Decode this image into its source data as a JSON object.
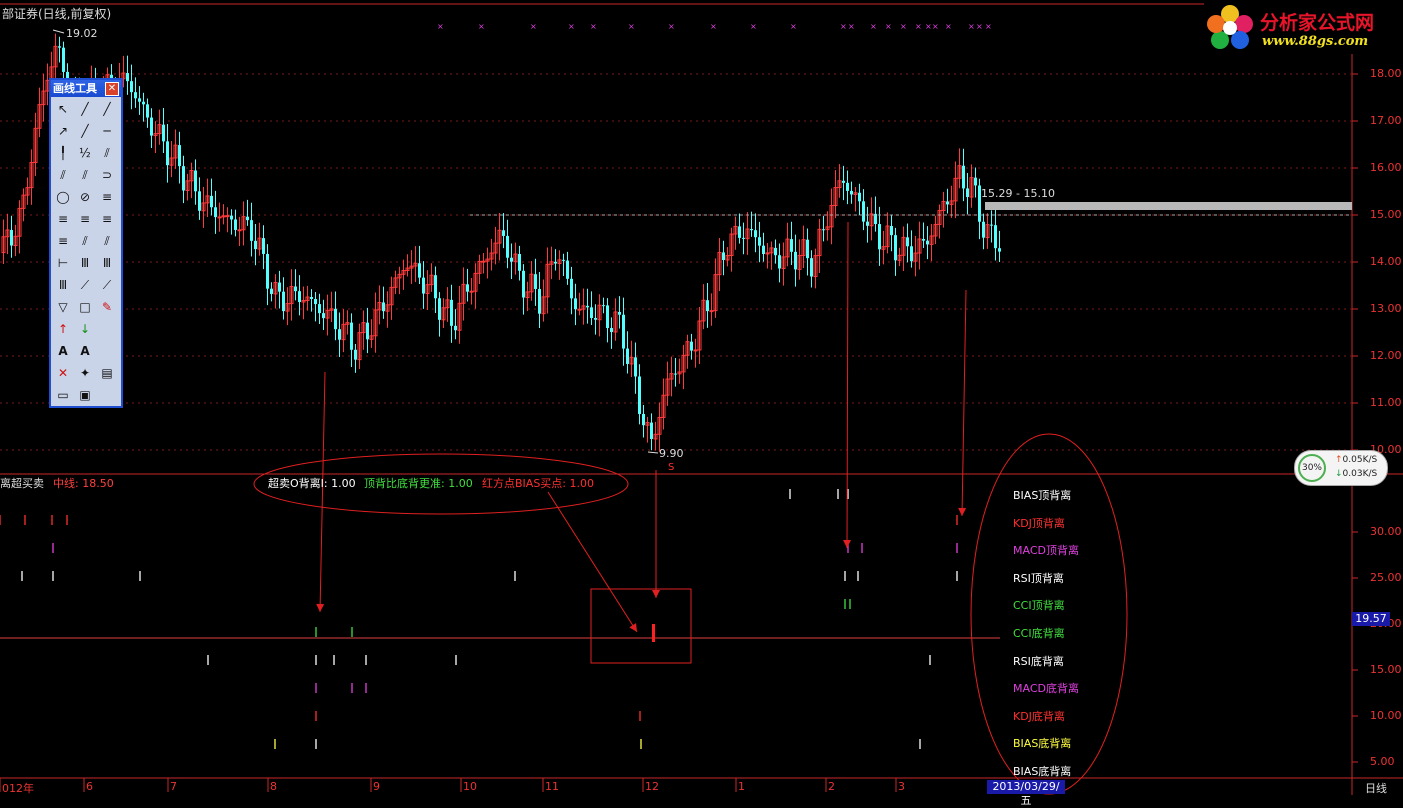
{
  "header": {
    "title": "部证券(日线,前复权)"
  },
  "price_axis": [
    "18.00",
    "17.00",
    "16.00",
    "15.00",
    "14.00",
    "13.00",
    "12.00",
    "11.00",
    "10.00"
  ],
  "indicator_axis": [
    "30.00",
    "25.00",
    "20.00",
    "15.00",
    "10.00",
    "5.00"
  ],
  "annotations": {
    "high_label": "19.02",
    "low_label": "9.90",
    "range_label": "15.29 - 15.10",
    "s_marker": "S"
  },
  "indicator_header": {
    "name": "离超买卖",
    "mid_label": "中线: 18.50",
    "line1": "超卖O背离I: 1.00",
    "line2": "顶背比底背更准: 1.00",
    "line3": "红方点BIAS买点: 1.00"
  },
  "legend": [
    {
      "text": "BIAS顶背离",
      "color": "#ffffff"
    },
    {
      "text": "KDJ顶背离",
      "color": "#ff3030"
    },
    {
      "text": "MACD顶背离",
      "color": "#e040e0"
    },
    {
      "text": "RSI顶背离",
      "color": "#ffffff"
    },
    {
      "text": "CCI顶背离",
      "color": "#40e040"
    },
    {
      "text": "CCI底背离",
      "color": "#40e040"
    },
    {
      "text": "RSI底背离",
      "color": "#ffffff"
    },
    {
      "text": "MACD底背离",
      "color": "#e040e0"
    },
    {
      "text": "KDJ底背离",
      "color": "#ff3030"
    },
    {
      "text": "BIAS底背离",
      "color": "#ffff40"
    },
    {
      "text": "BIAS底背离",
      "color": "#ffffff"
    }
  ],
  "x_axis_months": [
    "012年",
    "6",
    "7",
    "8",
    "9",
    "10",
    "11",
    "12",
    "1",
    "2",
    "3"
  ],
  "cursor_value": "19.57",
  "cursor_date": "2013/03/29/五",
  "period_label": "日线",
  "logo": {
    "brand": "分析家公式网",
    "url": "www.88gs.com"
  },
  "toolbox": {
    "title": "画线工具",
    "close": "✕"
  },
  "net_speed": {
    "percent": "30%",
    "up": "0.05K/S",
    "down": "0.03K/S"
  },
  "colors": {
    "up_candle": "#ff3a3a",
    "down_candle": "#54ffff",
    "axis": "#c82828",
    "grid": "#7a1818"
  }
}
